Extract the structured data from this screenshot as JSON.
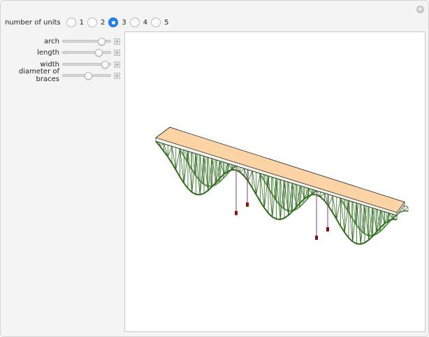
{
  "controls": {
    "units": {
      "label": "number of units",
      "options": [
        "1",
        "2",
        "3",
        "4",
        "5"
      ],
      "selected": "3"
    },
    "sliders": [
      {
        "label": "arch",
        "value": 0.84
      },
      {
        "label": "length",
        "value": 0.78
      },
      {
        "label": "width",
        "value": 0.93
      },
      {
        "label": "diameter of braces",
        "value": 0.52
      }
    ]
  },
  "colors": {
    "deck_top": "#fcd3a5",
    "truss": "#2f6e1c",
    "cable": "#8a3a8f",
    "pier": "#8b1010",
    "radio_selected": "#1f84f5"
  }
}
